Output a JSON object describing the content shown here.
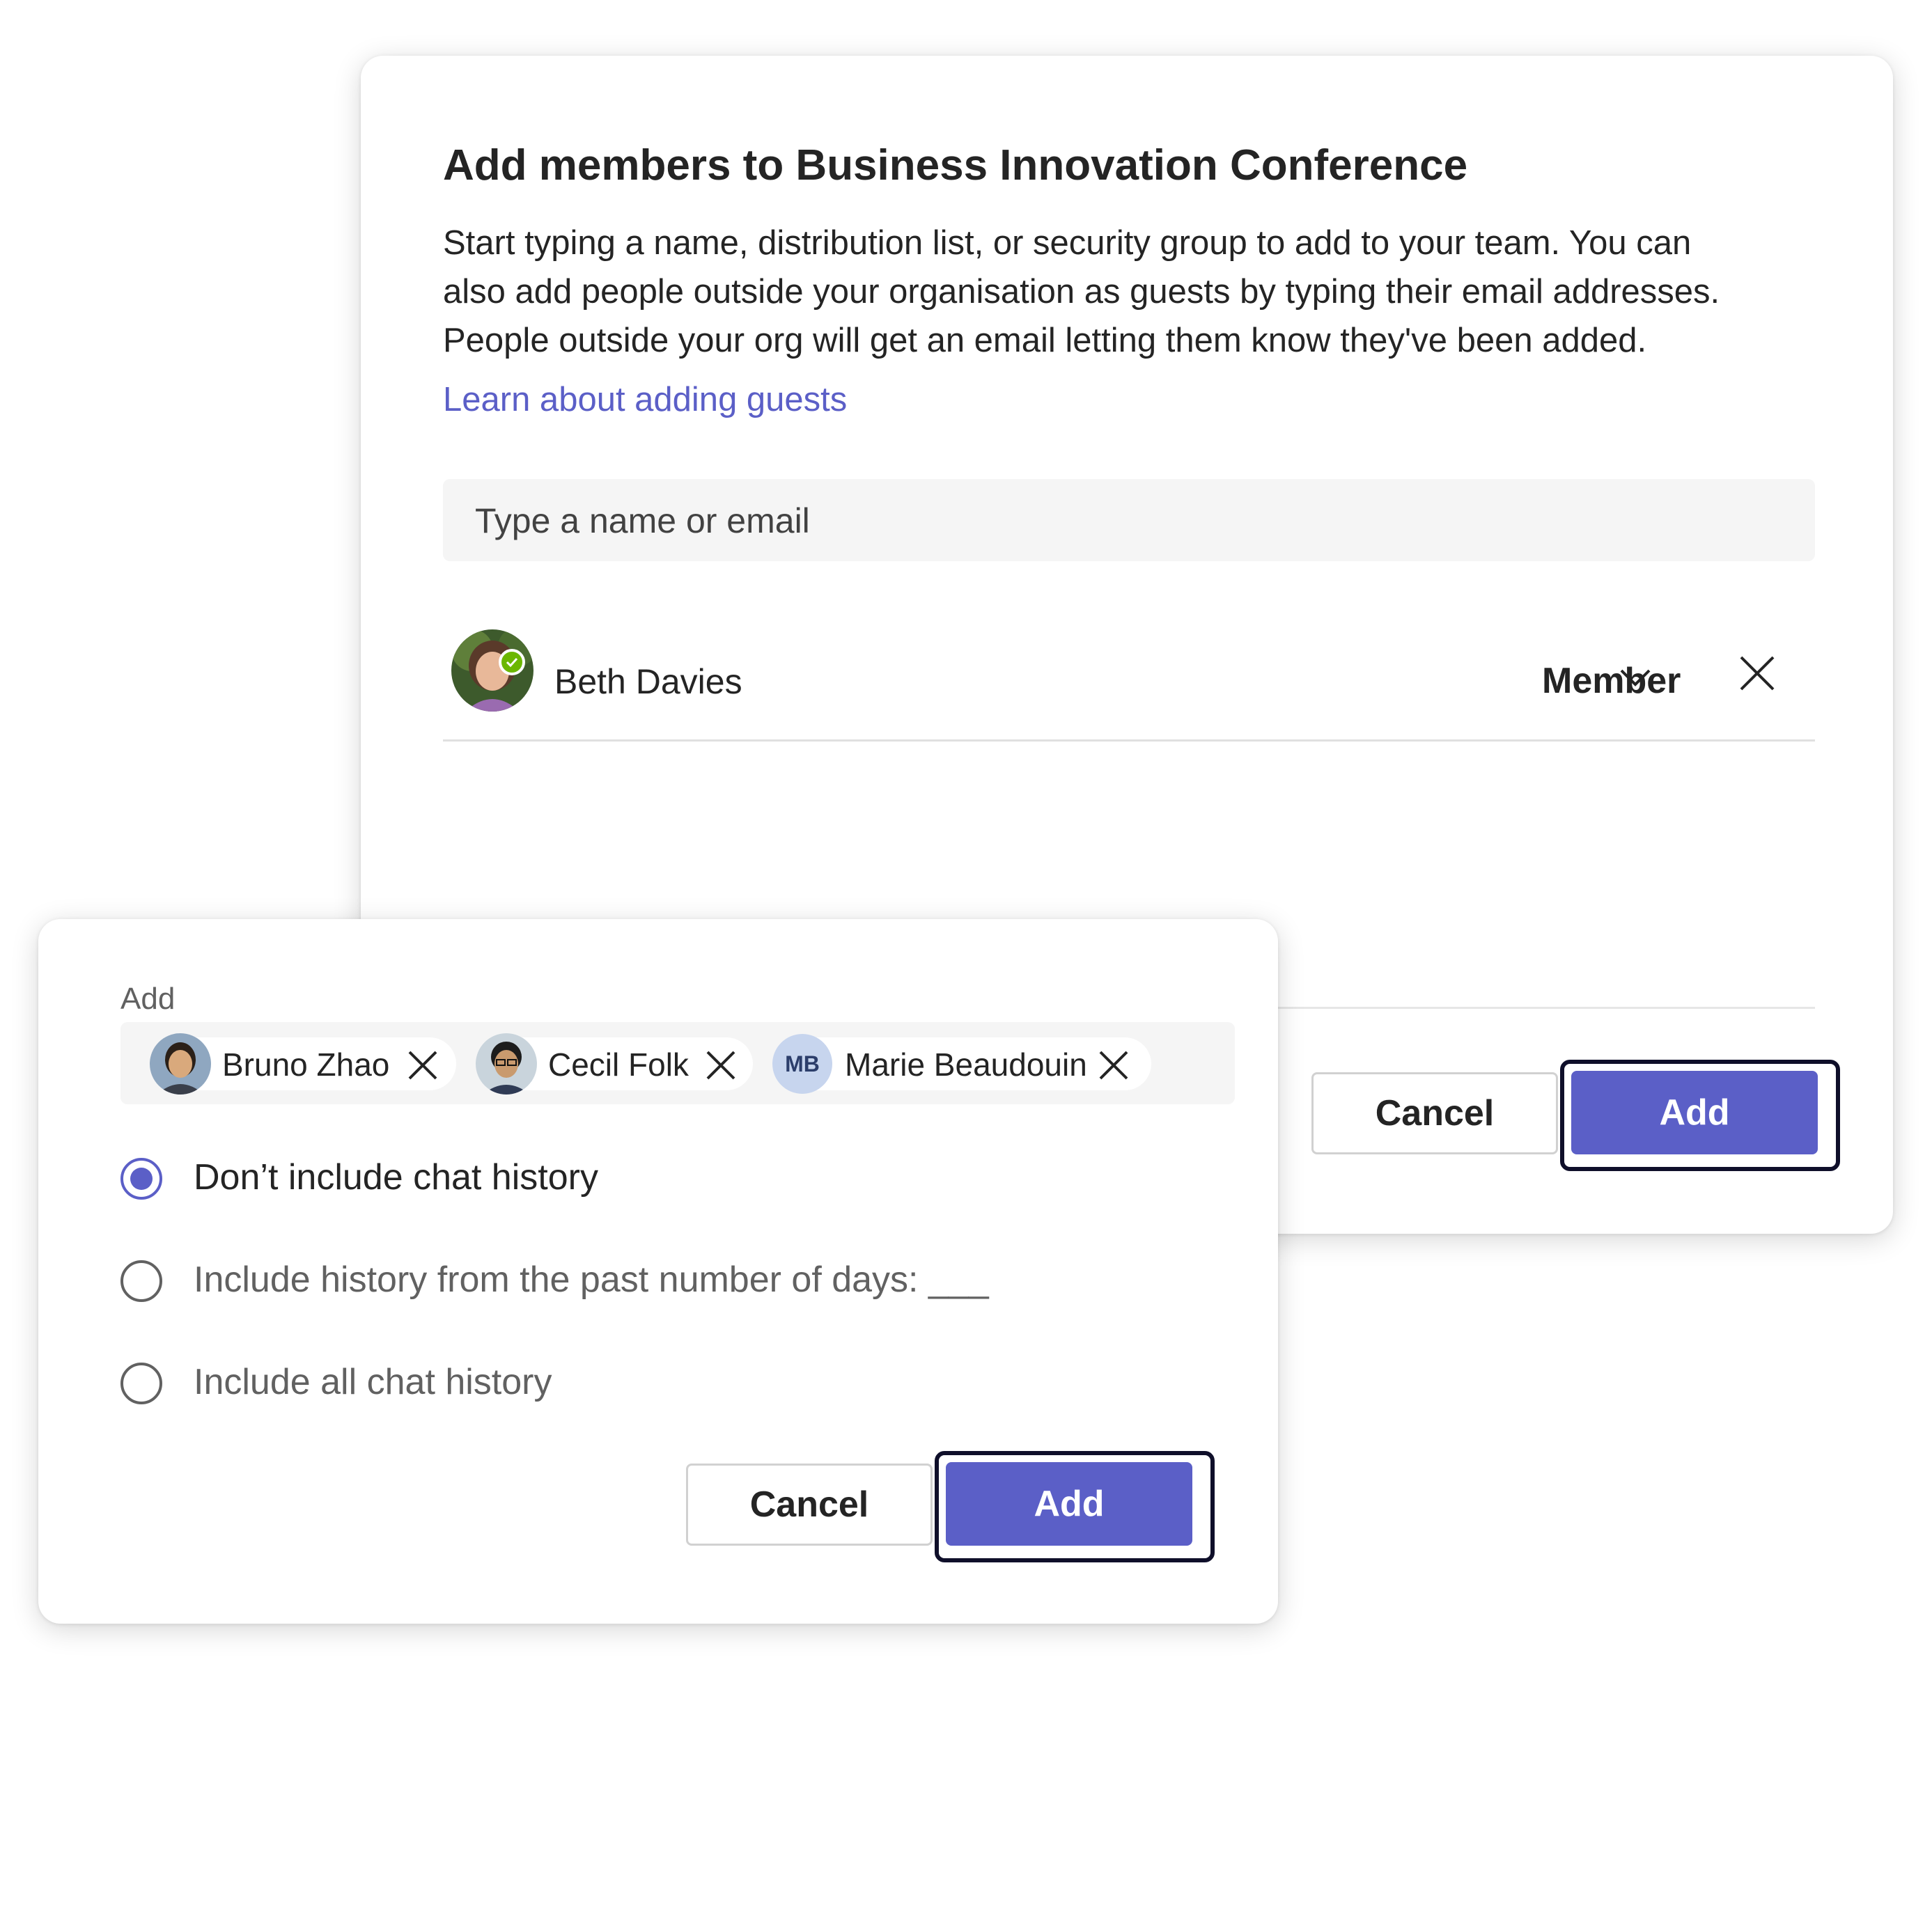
{
  "main_dialog": {
    "title": "Add members to Business Innovation Conference",
    "description_lines": [
      "Start typing a name, distribution list, or security group to add to your team. You can",
      "also add people outside your organisation as guests by typing their email addresses.",
      "People outside your org will get an email letting them know they've been added."
    ],
    "learn_link": "Learn about adding guests",
    "search_placeholder": "Type a name or email",
    "members": [
      {
        "name": "Beth Davies",
        "role": "Member",
        "presence": "available"
      }
    ],
    "cancel_label": "Cancel",
    "add_label": "Add"
  },
  "add_dialog": {
    "label": "Add",
    "chips": [
      {
        "name": "Bruno Zhao"
      },
      {
        "name": "Cecil Folk"
      },
      {
        "name": "Marie Beaudouin",
        "initials": "MB"
      }
    ],
    "history_options": [
      {
        "label": "Don’t include chat history",
        "selected": true
      },
      {
        "label": "Include history from the past number of days: ___",
        "selected": false
      },
      {
        "label": "Include all chat history",
        "selected": false
      }
    ],
    "cancel_label": "Cancel",
    "add_label": "Add"
  },
  "colors": {
    "accent": "#5b5fc7",
    "presence_available": "#6bb700",
    "focus_ring": "#0f0f2a",
    "field_bg": "#f5f5f5"
  },
  "icons": [
    "close-icon",
    "chevron-down-icon",
    "checkmark-icon"
  ]
}
